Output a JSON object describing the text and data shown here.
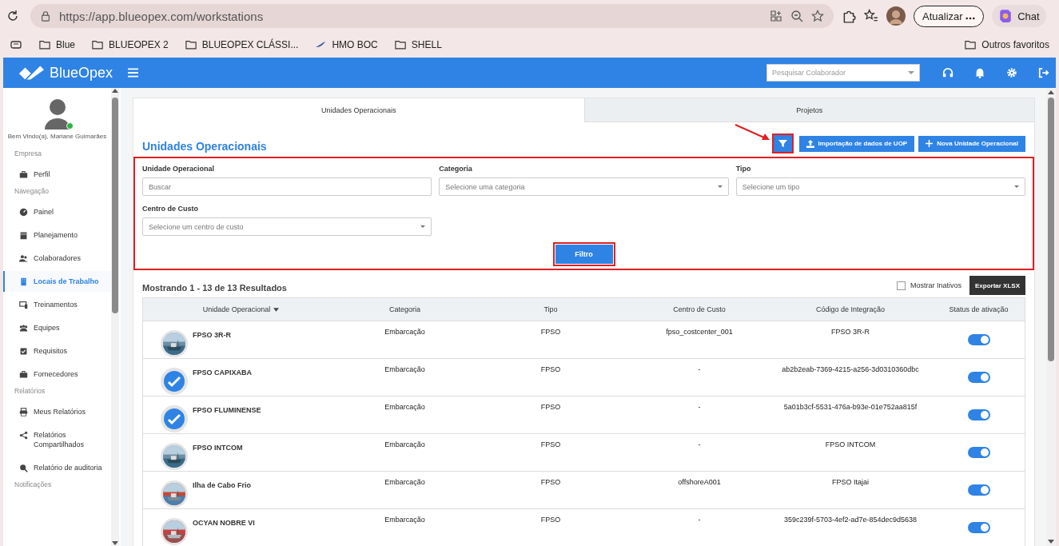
{
  "browser": {
    "url": "https://app.blueopex.com/workstations",
    "update_button": "Atualizar",
    "chat_button": "Chat",
    "bookmarks": [
      {
        "label": "Blue",
        "kind": "folder"
      },
      {
        "label": "BLUEOPEX 2",
        "kind": "folder"
      },
      {
        "label": "BLUEOPEX CLÁSSI...",
        "kind": "folder"
      },
      {
        "label": "HMO BOC",
        "kind": "site"
      },
      {
        "label": "SHELL",
        "kind": "folder"
      }
    ],
    "other_bookmarks": "Outros favoritos"
  },
  "header": {
    "brand": "BlueOpex",
    "search_placeholder": "Pesquisar Colaborador"
  },
  "sidebar": {
    "greeting": "Bem Vindo(a), Mariane Guimarães",
    "online": true,
    "sections": [
      {
        "title": "Empresa",
        "items": [
          {
            "label": "Perfil",
            "selected": false
          }
        ]
      },
      {
        "title": "Navegação",
        "items": [
          {
            "label": "Painel",
            "selected": false
          },
          {
            "label": "Planejamento",
            "selected": false
          },
          {
            "label": "Colaboradores",
            "selected": false
          },
          {
            "label": "Locais de Trabalho",
            "selected": true
          },
          {
            "label": "Treinamentos",
            "selected": false
          },
          {
            "label": "Equipes",
            "selected": false
          },
          {
            "label": "Requisitos",
            "selected": false
          },
          {
            "label": "Fornecedores",
            "selected": false
          }
        ]
      },
      {
        "title": "Relatórios",
        "items": [
          {
            "label": "Meus Relatórios",
            "selected": false
          },
          {
            "label": "Relatórios Compartilhados",
            "selected": false
          },
          {
            "label": "Relatório de auditoria",
            "selected": false
          }
        ]
      },
      {
        "title": "Notificações"
      }
    ]
  },
  "tabs": [
    {
      "label": "Unidades Operacionais",
      "selected": true
    },
    {
      "label": "Projetos",
      "selected": false
    }
  ],
  "title": "Unidades Operacionais",
  "buttons": [
    {
      "label": "Importação de dados de UOP",
      "kind": "upload"
    },
    {
      "label": "Nova Unidade Operacional",
      "kind": "add"
    }
  ],
  "filters": [
    {
      "label": "Unidade Operacional",
      "kind": "text",
      "placeholder": "Buscar"
    },
    {
      "label": "Categoria",
      "kind": "select",
      "placeholder": "Selecione uma categoria"
    },
    {
      "label": "Tipo",
      "kind": "select",
      "placeholder": "Selecione um tipo"
    },
    {
      "label": "Centro de Custo",
      "kind": "select",
      "placeholder": "Selecione um centro de custo"
    }
  ],
  "filter_button": "Filtro",
  "results": "Mostrando 1 - 13 de 13 Resultados",
  "show_inactive": {
    "label": "Mostrar Inativos",
    "checked": false
  },
  "export_button": "Exportar XLSX",
  "table": {
    "columns": [
      "Unidade Operacional",
      "Categoria",
      "Tipo",
      "Centro de Custo",
      "Código de Integração",
      "Status de ativação"
    ],
    "rows": [
      {
        "kind": "picture",
        "cells": [
          "FPSO 3R-R",
          "Embarcação",
          "FPSO",
          "fpso_costcenter_001",
          "FPSO 3R-R"
        ],
        "active": true
      },
      {
        "kind": "logo",
        "cells": [
          "FPSO CAPIXABA",
          "Embarcação",
          "FPSO",
          "-",
          "ab2b2eab-7369-4215-a256-3d0310360dbc"
        ],
        "active": true
      },
      {
        "kind": "logo",
        "cells": [
          "FPSO FLUMINENSE",
          "Embarcação",
          "FPSO",
          "-",
          "5a01b3cf-5531-476a-b93e-01e752aa815f"
        ],
        "active": true
      },
      {
        "kind": "picture",
        "cells": [
          "FPSO INTCOM",
          "Embarcação",
          "FPSO",
          "-",
          "FPSO INTCOM"
        ],
        "active": true
      },
      {
        "kind": "picture",
        "cells": [
          "Ilha de Cabo Frio",
          "Embarcação",
          "FPSO",
          "offshoreA001",
          "FPSO Itajai"
        ],
        "active": true
      },
      {
        "kind": "picture",
        "cells": [
          "OCYAN NOBRE VI",
          "Embarcação",
          "FPSO",
          "-",
          "359c239f-5703-4ef2-ad7e-854dec9d5638"
        ],
        "active": true
      }
    ]
  }
}
